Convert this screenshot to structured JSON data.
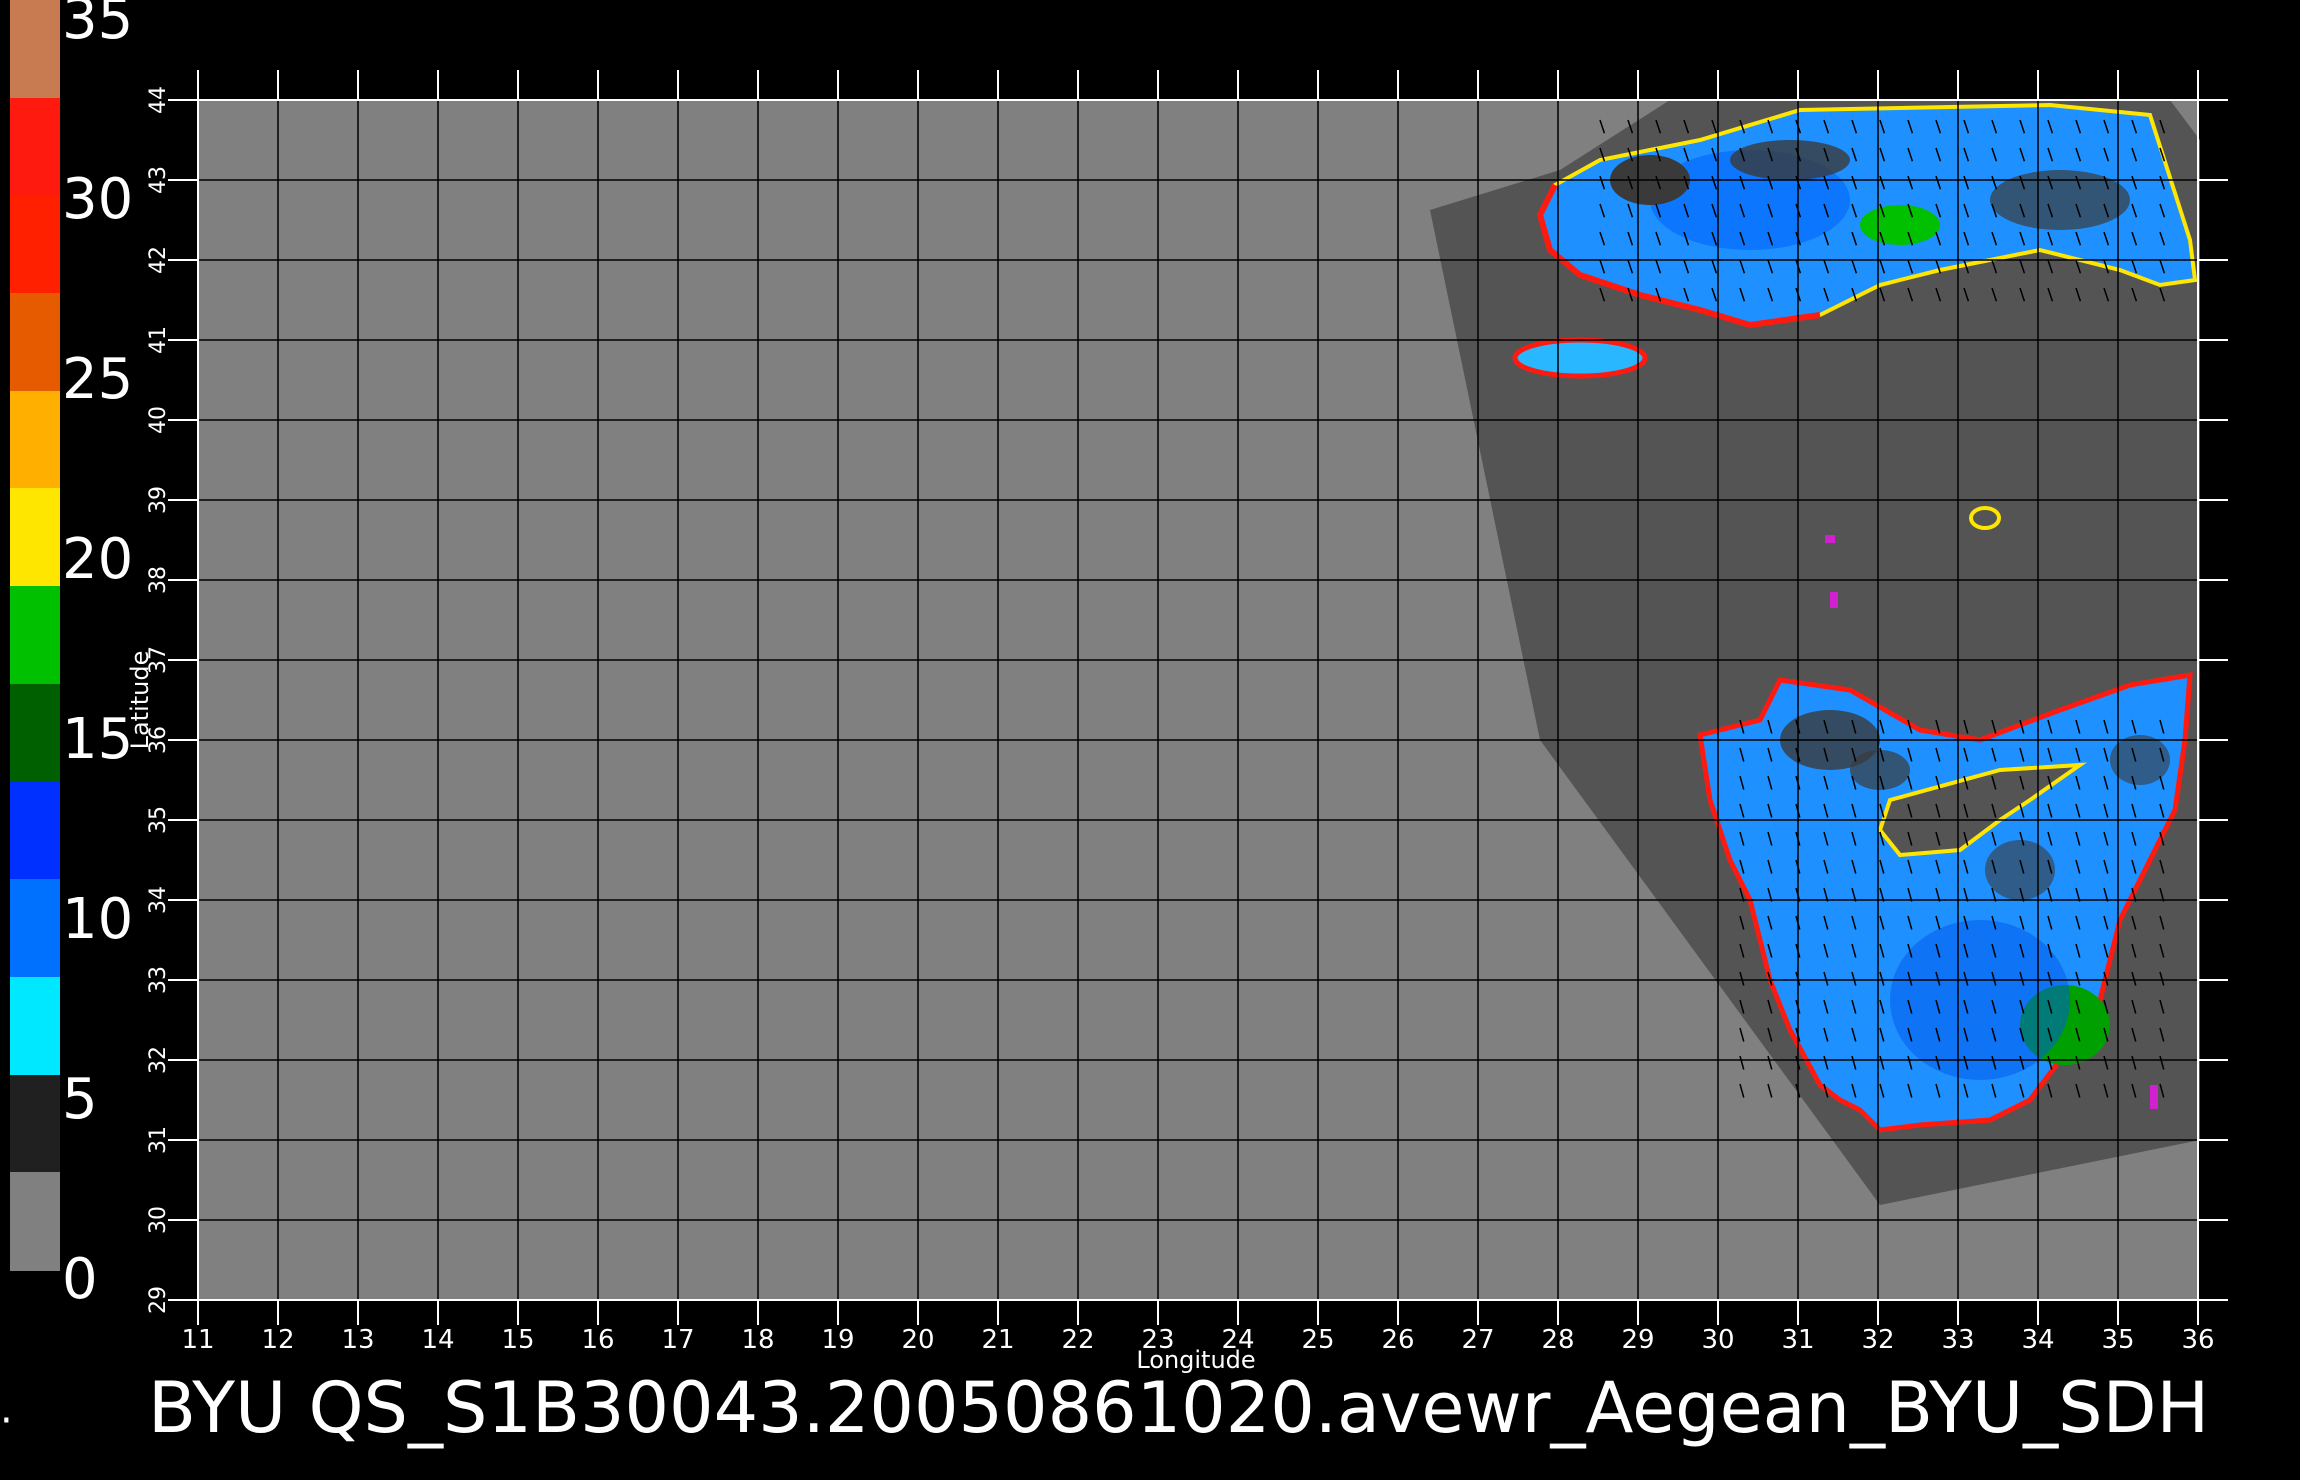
{
  "footer_title": "BYU  QS_S1B30043.20050861020.avewr_Aegean_BYU_SDH",
  "colorbar": {
    "ticks": [
      "35",
      "30",
      "25",
      "20",
      "15",
      "10",
      "5",
      "0"
    ],
    "colors": [
      "#c87a50",
      "#ff1a10",
      "#ff2000",
      "#e65a00",
      "#ffaf00",
      "#ffe600",
      "#00c000",
      "#006000",
      "#0030ff",
      "#0070ff",
      "#00e8ff",
      "#202020",
      "#808080"
    ]
  },
  "map": {
    "xlabel": "Longitude",
    "ylabel": "Latitude",
    "lon_ticks": [
      "11",
      "12",
      "13",
      "14",
      "15",
      "16",
      "17",
      "18",
      "19",
      "20",
      "21",
      "22",
      "23",
      "24",
      "25",
      "26",
      "27",
      "28",
      "29",
      "30",
      "31",
      "32",
      "33",
      "34",
      "35",
      "36"
    ],
    "lat_ticks": [
      "29",
      "30",
      "31",
      "32",
      "33",
      "34",
      "35",
      "36",
      "37",
      "38",
      "39",
      "40",
      "41",
      "42",
      "43",
      "44"
    ],
    "lon_range": [
      11,
      36
    ],
    "lat_range": [
      29,
      44
    ],
    "background_color": "#808080",
    "swath_color": "#545454"
  }
}
